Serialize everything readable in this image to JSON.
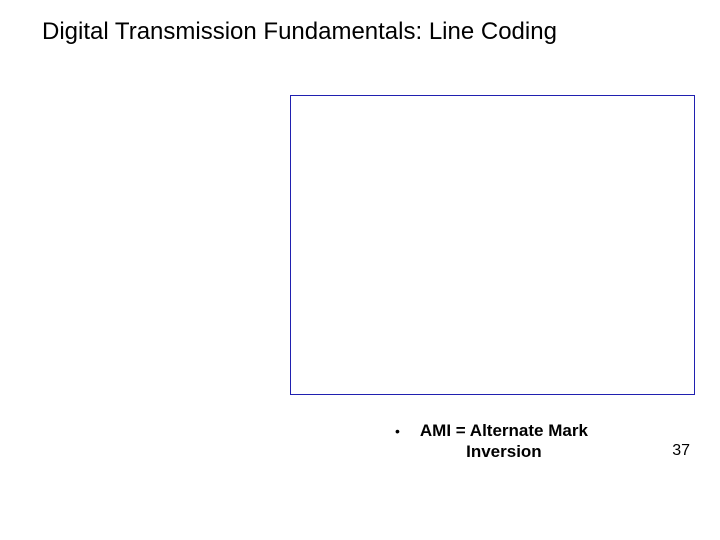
{
  "slide": {
    "title": "Digital Transmission Fundamentals: Line Coding",
    "bullet": {
      "marker": "•",
      "line1": "AMI = Alternate Mark",
      "line2": "Inversion"
    },
    "page_number": "37"
  }
}
